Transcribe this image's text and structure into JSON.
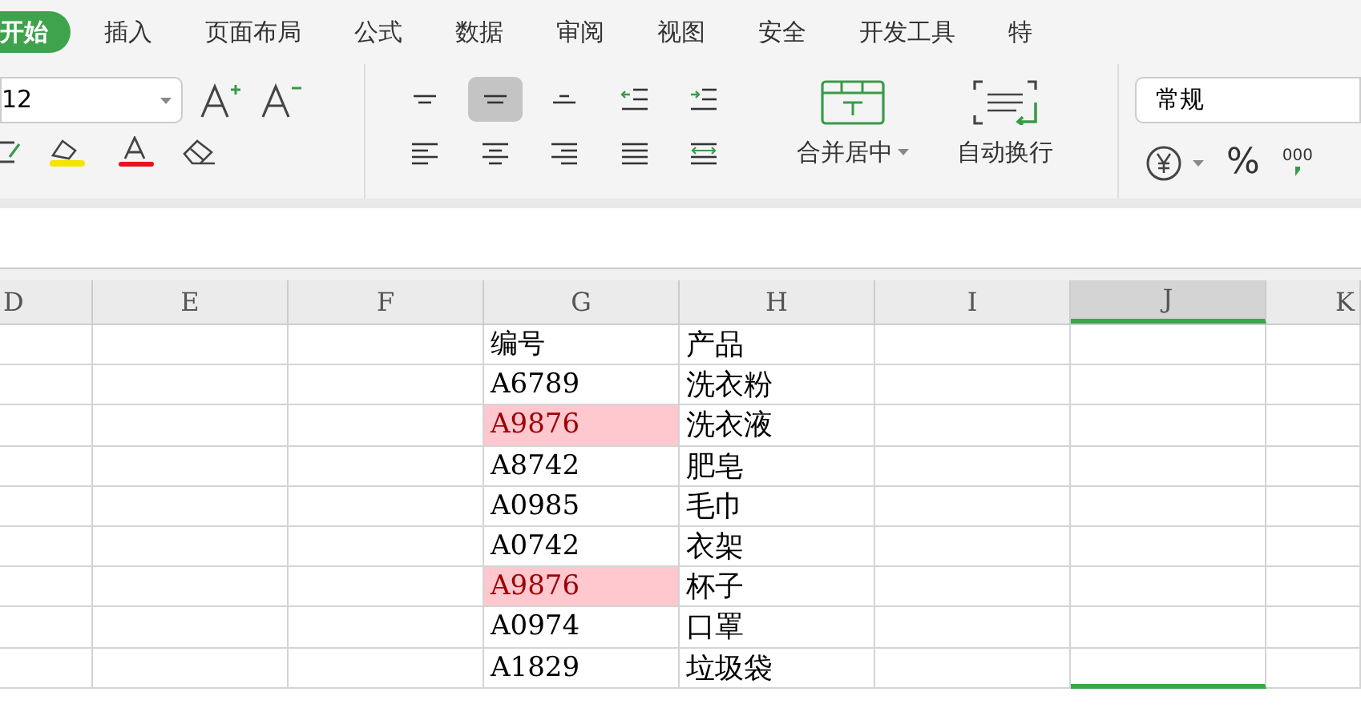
{
  "ribbon_tabs": [
    {
      "label": "开始",
      "selected": true
    },
    {
      "label": "插入",
      "selected": false
    },
    {
      "label": "页面布局",
      "selected": false
    },
    {
      "label": "公式",
      "selected": false
    },
    {
      "label": "数据",
      "selected": false
    },
    {
      "label": "审阅",
      "selected": false
    },
    {
      "label": "视图",
      "selected": false
    },
    {
      "label": "安全",
      "selected": false
    },
    {
      "label": "开发工具",
      "selected": false
    },
    {
      "label": "特",
      "selected": false
    }
  ],
  "font_size": "12",
  "alignment_buttons": [
    {
      "kind": "top",
      "selected": false
    },
    {
      "kind": "middle",
      "selected": true
    },
    {
      "kind": "bottom",
      "selected": false
    },
    {
      "kind": "outdent",
      "selected": false
    },
    {
      "kind": "indent",
      "selected": false
    },
    {
      "kind": "left",
      "selected": false
    },
    {
      "kind": "center",
      "selected": false
    },
    {
      "kind": "right",
      "selected": false
    },
    {
      "kind": "justify",
      "selected": false
    },
    {
      "kind": "distributed",
      "selected": false
    }
  ],
  "merge_button": "合并居中",
  "wrap_button": "自动换行",
  "number_format": "常规",
  "percent_button": "%",
  "thousands_button": "000",
  "column_headers": [
    {
      "label": "D",
      "selected": false
    },
    {
      "label": "E",
      "selected": false
    },
    {
      "label": "F",
      "selected": false
    },
    {
      "label": "G",
      "selected": false
    },
    {
      "label": "H",
      "selected": false
    },
    {
      "label": "I",
      "selected": false
    },
    {
      "label": "J",
      "selected": true
    },
    {
      "label": "K",
      "selected": false
    }
  ],
  "rows": [
    {
      "code": "编号",
      "product": "产品",
      "highlighted": false
    },
    {
      "code": "A6789",
      "product": "洗衣粉",
      "highlighted": false
    },
    {
      "code": "A9876",
      "product": "洗衣液",
      "highlighted": true
    },
    {
      "code": "A8742",
      "product": "肥皂",
      "highlighted": false
    },
    {
      "code": "A0985",
      "product": "毛巾",
      "highlighted": false
    },
    {
      "code": "A0742",
      "product": "衣架",
      "highlighted": false
    },
    {
      "code": "A9876",
      "product": "杯子",
      "highlighted": true
    },
    {
      "code": "A0974",
      "product": "口罩",
      "highlighted": false
    },
    {
      "code": "A1829",
      "product": "垃圾袋",
      "highlighted": false
    }
  ]
}
